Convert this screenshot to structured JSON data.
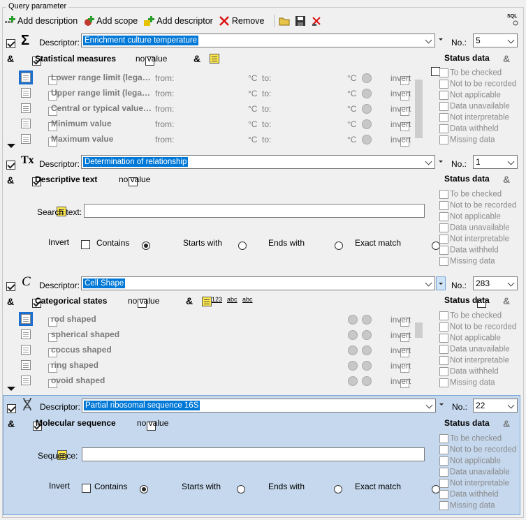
{
  "group_title": "Query parameter",
  "toolbar": {
    "add_description": "Add description",
    "add_scope": "Add scope",
    "add_descriptor": "Add descriptor",
    "remove": "Remove",
    "sql": "SQL"
  },
  "common": {
    "descriptor_label": "Descriptor:",
    "no_label": "No.:",
    "no_value": "no value",
    "status_data": "Status data",
    "invert": "invert",
    "from": "from:",
    "to": "to:",
    "unit": "°C",
    "amp": "&",
    "invert_cap": "Invert",
    "contains": "Contains",
    "starts_with": "Starts with",
    "ends_with": "Ends with",
    "exact_match": "Exact match",
    "search_text": "Search text:",
    "sequence": "Sequence:"
  },
  "status_items": [
    "To be checked",
    "Not to be recorded",
    "Not applicable",
    "Data unavailable",
    "Not interpretable",
    "Data withheld",
    "Missing data"
  ],
  "panels": [
    {
      "type": "quantitative",
      "descriptor": "Enrichment culture temperature",
      "no": "5",
      "section": "Statistical measures",
      "rows": [
        "Lower range limit (lega…",
        "Upper range limit (lega…",
        "Central or typical value…",
        "Minimum value",
        "Maximum value"
      ]
    },
    {
      "type": "text",
      "descriptor": "Determination of relationship",
      "no": "1",
      "section": "Descriptive text"
    },
    {
      "type": "categorical",
      "descriptor": "Cell Shape",
      "no": "283",
      "section": "Categorical states",
      "rows": [
        "rod shaped",
        "spherical shaped",
        "coccus shaped",
        "ring shaped",
        "ovoid shaped"
      ]
    },
    {
      "type": "sequence",
      "descriptor": "Partial ribosomal sequence 16S",
      "no": "22",
      "section": "Molecular sequence"
    }
  ]
}
